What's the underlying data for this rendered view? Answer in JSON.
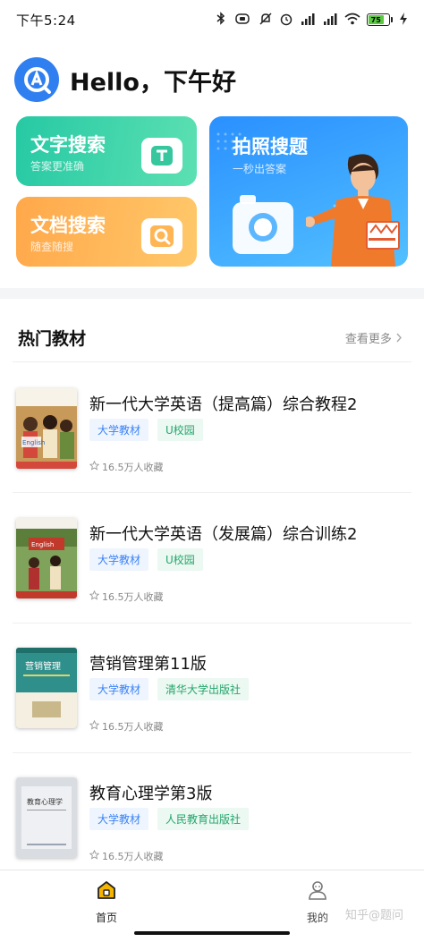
{
  "status_bar": {
    "time": "下午5:24",
    "battery": "75",
    "icons": [
      "bluetooth-icon",
      "vibrate-icon",
      "mute-icon",
      "alarm-icon",
      "signal-icon",
      "signal-icon",
      "wifi-icon",
      "battery-icon",
      "charging-icon"
    ]
  },
  "header": {
    "greeting": "Hello，下午好"
  },
  "features": {
    "text_search": {
      "title": "文字搜索",
      "subtitle": "答案更准确"
    },
    "doc_search": {
      "title": "文档搜索",
      "subtitle": "随查随搜"
    },
    "photo_search": {
      "title": "拍照搜题",
      "subtitle": "一秒出答案"
    }
  },
  "section": {
    "title": "热门教材",
    "more": "查看更多"
  },
  "books": [
    {
      "title": "新一代大学英语（提高篇）综合教程2",
      "tags": [
        "大学教材",
        "U校园"
      ],
      "favorites": "16.5万人收藏"
    },
    {
      "title": "新一代大学英语（发展篇）综合训练2",
      "tags": [
        "大学教材",
        "U校园"
      ],
      "favorites": "16.5万人收藏"
    },
    {
      "title": "营销管理第11版",
      "tags": [
        "大学教材",
        "清华大学出版社"
      ],
      "favorites": "16.5万人收藏"
    },
    {
      "title": "教育心理学第3版",
      "tags": [
        "大学教材",
        "人民教育出版社"
      ],
      "favorites": "16.5万人收藏"
    }
  ],
  "covers": {
    "book3_title": "营销管理",
    "book4_title": "教育心理学"
  },
  "nav": {
    "home": "首页",
    "mine": "我的"
  },
  "watermark": "知乎@题问",
  "colors": {
    "accent": "#f5a623",
    "blue": "#3b82f6",
    "green": "#22a66a"
  }
}
